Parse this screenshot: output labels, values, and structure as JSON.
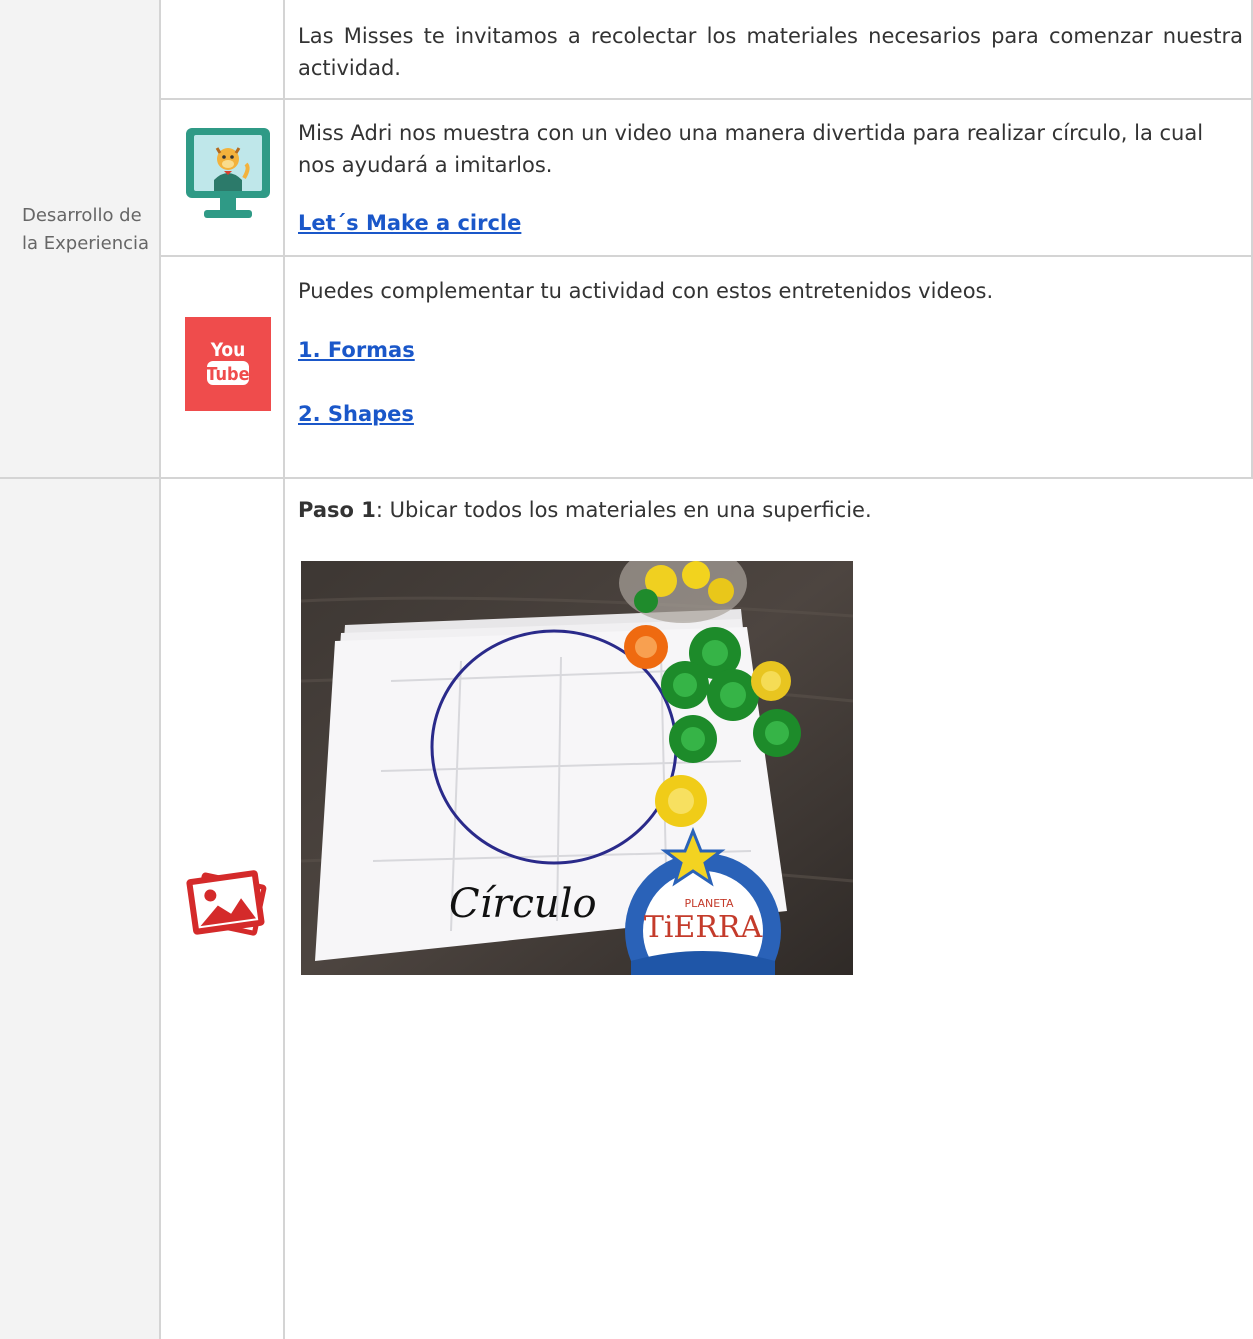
{
  "section_label": "Desarrollo de la Experiencia",
  "row1": {
    "text": "Las Misses te invitamos a recolectar los materiales necesarios para comenzar nuestra actividad."
  },
  "row2": {
    "icon": "video-lesson-icon",
    "text": "Miss Adri nos muestra con un video una manera divertida para realizar círculo, la cual nos ayudará a imitarlos.",
    "link": "Let´s Make a circle"
  },
  "row3": {
    "icon": "youtube-icon",
    "icon_text_top": "You",
    "icon_text_bottom": "Tube",
    "text": "Puedes complementar tu actividad con estos entretenidos videos.",
    "links": [
      "1. Formas",
      "2. Shapes"
    ]
  },
  "row4": {
    "icon": "image-gallery-icon",
    "step_bold": "Paso 1",
    "step_text": ": Ubicar todos los materiales en una superficie.",
    "photo": {
      "handwritten": "Círculo",
      "logo_small": "PLANETA",
      "logo_big": "TiERRA"
    }
  },
  "colors": {
    "link": "#1a57c9",
    "youtube_red": "#ef4c4c",
    "monitor_teal": "#2f9a86",
    "border": "#d4d4d4",
    "label_bg": "#f3f3f3"
  }
}
